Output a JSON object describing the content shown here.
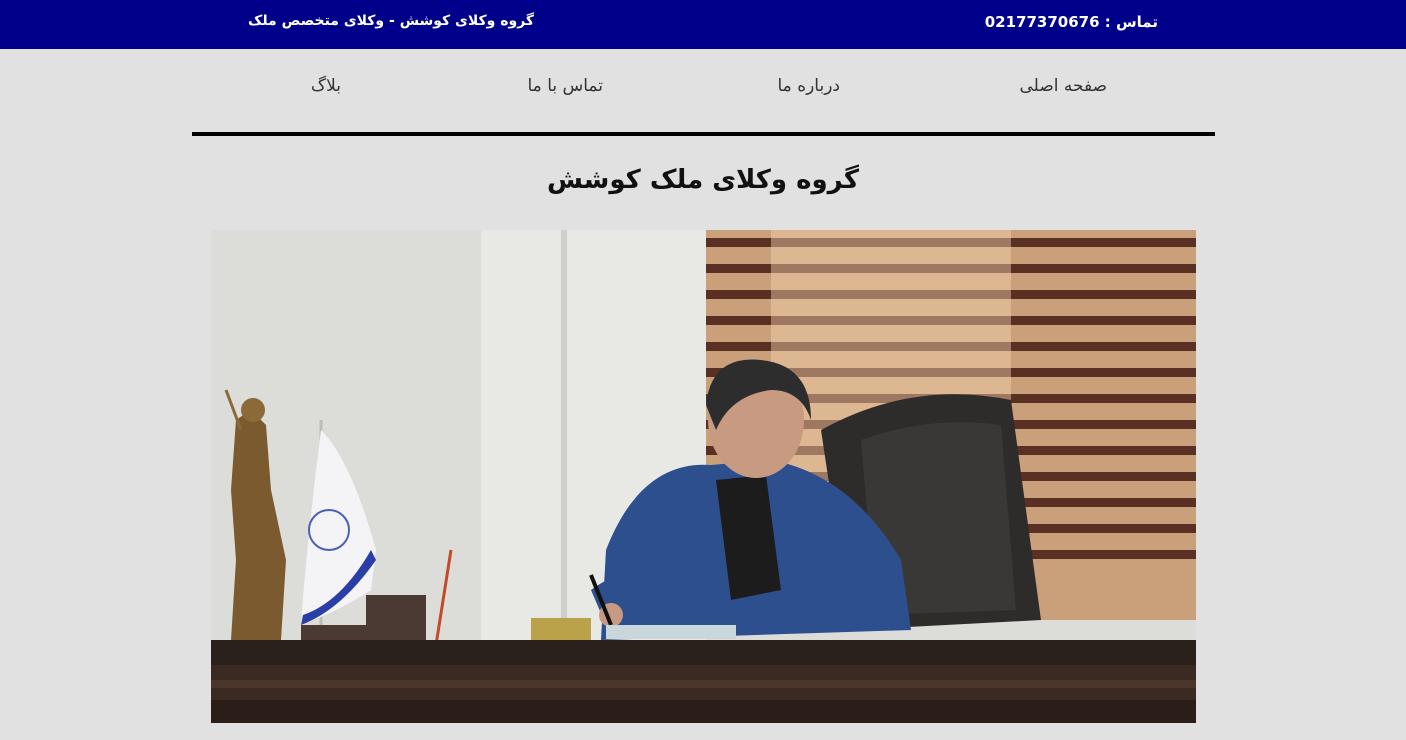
{
  "topbar": {
    "phone": "تماس : 02177370676",
    "tagline": "گروه وکلای کوشش - وکلای متخصص ملک"
  },
  "nav": {
    "items": [
      "صفحه اصلی",
      "درباره ما",
      "تماس با ما",
      "بلاگ"
    ]
  },
  "main": {
    "title": "گروه وکلای ملک کوشش"
  },
  "colors": {
    "topbar_bg": "#00008b",
    "page_bg": "#e1e1e1"
  }
}
